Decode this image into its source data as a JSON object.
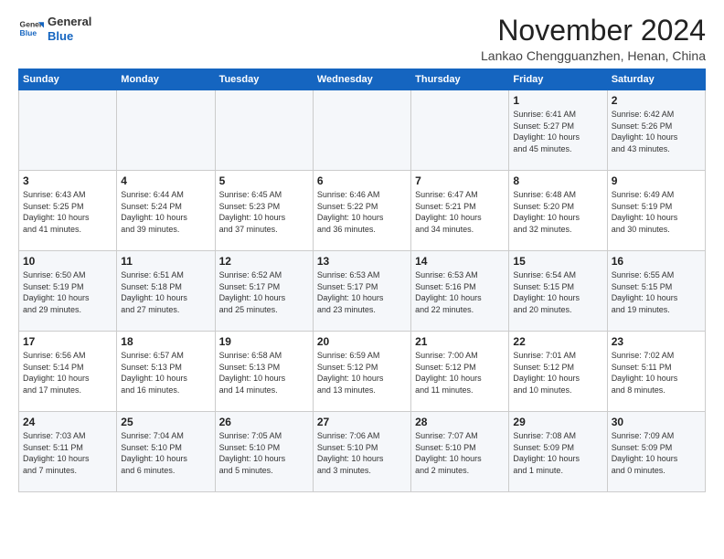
{
  "logo": {
    "line1": "General",
    "line2": "Blue"
  },
  "title": "November 2024",
  "location": "Lankao Chengguanzhen, Henan, China",
  "weekdays": [
    "Sunday",
    "Monday",
    "Tuesday",
    "Wednesday",
    "Thursday",
    "Friday",
    "Saturday"
  ],
  "weeks": [
    [
      {
        "day": "",
        "info": ""
      },
      {
        "day": "",
        "info": ""
      },
      {
        "day": "",
        "info": ""
      },
      {
        "day": "",
        "info": ""
      },
      {
        "day": "",
        "info": ""
      },
      {
        "day": "1",
        "info": "Sunrise: 6:41 AM\nSunset: 5:27 PM\nDaylight: 10 hours\nand 45 minutes."
      },
      {
        "day": "2",
        "info": "Sunrise: 6:42 AM\nSunset: 5:26 PM\nDaylight: 10 hours\nand 43 minutes."
      }
    ],
    [
      {
        "day": "3",
        "info": "Sunrise: 6:43 AM\nSunset: 5:25 PM\nDaylight: 10 hours\nand 41 minutes."
      },
      {
        "day": "4",
        "info": "Sunrise: 6:44 AM\nSunset: 5:24 PM\nDaylight: 10 hours\nand 39 minutes."
      },
      {
        "day": "5",
        "info": "Sunrise: 6:45 AM\nSunset: 5:23 PM\nDaylight: 10 hours\nand 37 minutes."
      },
      {
        "day": "6",
        "info": "Sunrise: 6:46 AM\nSunset: 5:22 PM\nDaylight: 10 hours\nand 36 minutes."
      },
      {
        "day": "7",
        "info": "Sunrise: 6:47 AM\nSunset: 5:21 PM\nDaylight: 10 hours\nand 34 minutes."
      },
      {
        "day": "8",
        "info": "Sunrise: 6:48 AM\nSunset: 5:20 PM\nDaylight: 10 hours\nand 32 minutes."
      },
      {
        "day": "9",
        "info": "Sunrise: 6:49 AM\nSunset: 5:19 PM\nDaylight: 10 hours\nand 30 minutes."
      }
    ],
    [
      {
        "day": "10",
        "info": "Sunrise: 6:50 AM\nSunset: 5:19 PM\nDaylight: 10 hours\nand 29 minutes."
      },
      {
        "day": "11",
        "info": "Sunrise: 6:51 AM\nSunset: 5:18 PM\nDaylight: 10 hours\nand 27 minutes."
      },
      {
        "day": "12",
        "info": "Sunrise: 6:52 AM\nSunset: 5:17 PM\nDaylight: 10 hours\nand 25 minutes."
      },
      {
        "day": "13",
        "info": "Sunrise: 6:53 AM\nSunset: 5:17 PM\nDaylight: 10 hours\nand 23 minutes."
      },
      {
        "day": "14",
        "info": "Sunrise: 6:53 AM\nSunset: 5:16 PM\nDaylight: 10 hours\nand 22 minutes."
      },
      {
        "day": "15",
        "info": "Sunrise: 6:54 AM\nSunset: 5:15 PM\nDaylight: 10 hours\nand 20 minutes."
      },
      {
        "day": "16",
        "info": "Sunrise: 6:55 AM\nSunset: 5:15 PM\nDaylight: 10 hours\nand 19 minutes."
      }
    ],
    [
      {
        "day": "17",
        "info": "Sunrise: 6:56 AM\nSunset: 5:14 PM\nDaylight: 10 hours\nand 17 minutes."
      },
      {
        "day": "18",
        "info": "Sunrise: 6:57 AM\nSunset: 5:13 PM\nDaylight: 10 hours\nand 16 minutes."
      },
      {
        "day": "19",
        "info": "Sunrise: 6:58 AM\nSunset: 5:13 PM\nDaylight: 10 hours\nand 14 minutes."
      },
      {
        "day": "20",
        "info": "Sunrise: 6:59 AM\nSunset: 5:12 PM\nDaylight: 10 hours\nand 13 minutes."
      },
      {
        "day": "21",
        "info": "Sunrise: 7:00 AM\nSunset: 5:12 PM\nDaylight: 10 hours\nand 11 minutes."
      },
      {
        "day": "22",
        "info": "Sunrise: 7:01 AM\nSunset: 5:12 PM\nDaylight: 10 hours\nand 10 minutes."
      },
      {
        "day": "23",
        "info": "Sunrise: 7:02 AM\nSunset: 5:11 PM\nDaylight: 10 hours\nand 8 minutes."
      }
    ],
    [
      {
        "day": "24",
        "info": "Sunrise: 7:03 AM\nSunset: 5:11 PM\nDaylight: 10 hours\nand 7 minutes."
      },
      {
        "day": "25",
        "info": "Sunrise: 7:04 AM\nSunset: 5:10 PM\nDaylight: 10 hours\nand 6 minutes."
      },
      {
        "day": "26",
        "info": "Sunrise: 7:05 AM\nSunset: 5:10 PM\nDaylight: 10 hours\nand 5 minutes."
      },
      {
        "day": "27",
        "info": "Sunrise: 7:06 AM\nSunset: 5:10 PM\nDaylight: 10 hours\nand 3 minutes."
      },
      {
        "day": "28",
        "info": "Sunrise: 7:07 AM\nSunset: 5:10 PM\nDaylight: 10 hours\nand 2 minutes."
      },
      {
        "day": "29",
        "info": "Sunrise: 7:08 AM\nSunset: 5:09 PM\nDaylight: 10 hours\nand 1 minute."
      },
      {
        "day": "30",
        "info": "Sunrise: 7:09 AM\nSunset: 5:09 PM\nDaylight: 10 hours\nand 0 minutes."
      }
    ]
  ]
}
